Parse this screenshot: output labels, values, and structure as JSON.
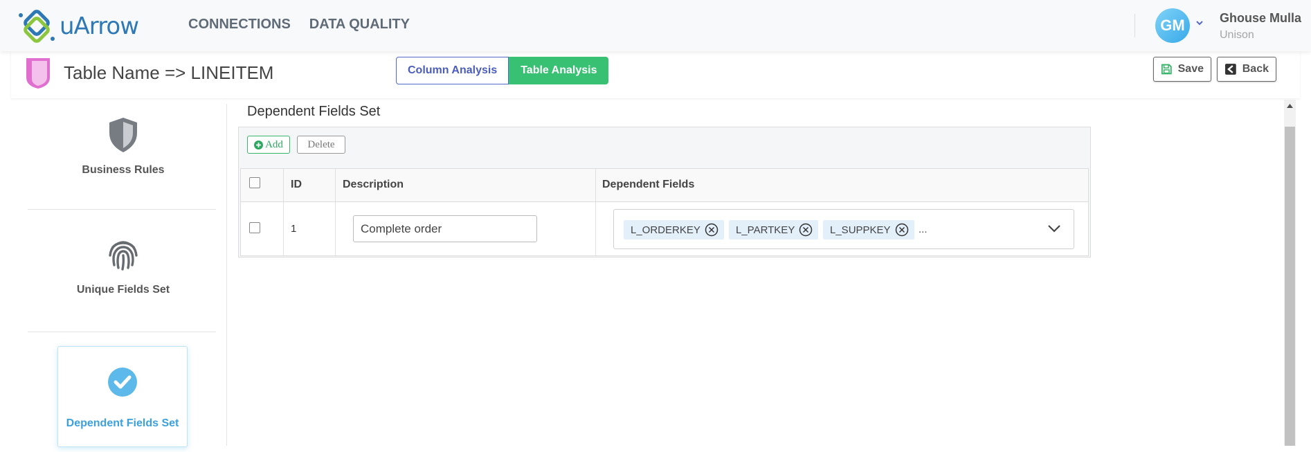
{
  "brand": {
    "name": "uArrow"
  },
  "nav": {
    "items": [
      "CONNECTIONS",
      "DATA QUALITY"
    ]
  },
  "user": {
    "initials": "GM",
    "name": "Ghouse Mulla",
    "org": "Unison"
  },
  "header": {
    "title": "Table Name => LINEITEM",
    "tabs": {
      "column_analysis": "Column Analysis",
      "table_analysis": "Table Analysis"
    },
    "save_label": "Save",
    "back_label": "Back"
  },
  "sidebar": {
    "items": [
      {
        "label": "Business Rules",
        "icon": "shield-icon"
      },
      {
        "label": "Unique Fields Set",
        "icon": "fingerprint-icon"
      },
      {
        "label": "Dependent Fields Set",
        "icon": "check-circle-icon",
        "active": true
      }
    ]
  },
  "content": {
    "section_title": "Dependent Fields Set",
    "add_label": "Add",
    "delete_label": "Delete",
    "columns": {
      "id": "ID",
      "description": "Description",
      "dependent_fields": "Dependent Fields"
    },
    "rows": [
      {
        "id": "1",
        "description": "Complete order",
        "dependent_fields": [
          "L_ORDERKEY",
          "L_PARTKEY",
          "L_SUPPKEY"
        ],
        "more": "..."
      }
    ]
  },
  "colors": {
    "accent_green": "#38c172",
    "accent_blue": "#4b5cbf",
    "active_sidebar": "#3aa0df",
    "tag_bg": "#e3f0fa"
  }
}
